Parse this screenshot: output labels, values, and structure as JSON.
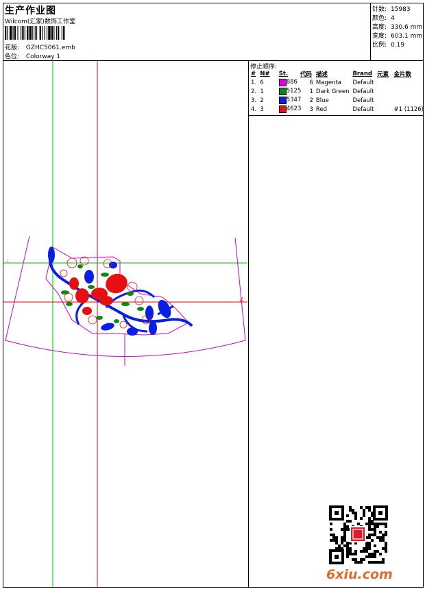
{
  "header": {
    "title": "生产作业图",
    "studio": "Wilcom(汇家)数饰工作室",
    "design_label": "花版:",
    "design_value": "GZHC5061.emb",
    "colorway_label": "色位:",
    "colorway_value": "Colorway 1"
  },
  "specs": [
    {
      "label": "针数:",
      "value": "15983"
    },
    {
      "label": "颜色:",
      "value": "4"
    },
    {
      "label": "高度:",
      "value": "330.6 mm"
    },
    {
      "label": "宽度:",
      "value": "603.1 mm"
    },
    {
      "label": "比例:",
      "value": "0.19"
    }
  ],
  "stop_sequence": {
    "title": "停止顺序:",
    "columns": [
      "#",
      "N#",
      "St.",
      "代码",
      "描述",
      "Brand",
      "元素",
      "金片数"
    ],
    "rows": [
      {
        "index": "1.",
        "n": "6",
        "color": "#e400e4",
        "st": "886",
        "code": "6",
        "desc": "Magenta",
        "brand": "Default",
        "elem": "",
        "seq": ""
      },
      {
        "index": "2.",
        "n": "1",
        "color": "#0a8a10",
        "st": "5125",
        "code": "1",
        "desc": "Dark Green",
        "brand": "Default",
        "elem": "",
        "seq": ""
      },
      {
        "index": "3.",
        "n": "2",
        "color": "#0a1ee6",
        "st": "5347",
        "code": "2",
        "desc": "Blue",
        "brand": "Default",
        "elem": "",
        "seq": ""
      },
      {
        "index": "4.",
        "n": "3",
        "color": "#e61010",
        "st": "4623",
        "code": "3",
        "desc": "Red",
        "brand": "Default",
        "elem": "",
        "seq": "#1 (1126)"
      }
    ]
  },
  "watermark": "6xiu.com"
}
